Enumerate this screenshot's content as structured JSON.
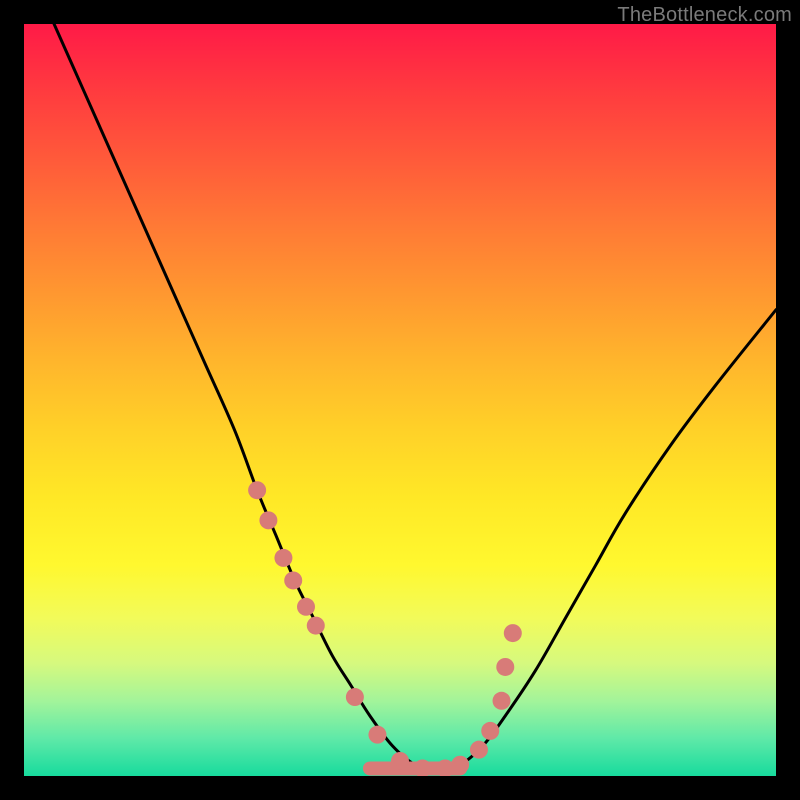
{
  "watermark": "TheBottleneck.com",
  "chart_data": {
    "type": "line",
    "title": "",
    "xlabel": "",
    "ylabel": "",
    "xlim": [
      0,
      100
    ],
    "ylim": [
      0,
      100
    ],
    "grid": false,
    "legend": false,
    "series": [
      {
        "name": "bottleneck-curve",
        "color": "#000000",
        "x": [
          4,
          8,
          12,
          16,
          20,
          24,
          28,
          31,
          33.5,
          36,
          38.5,
          41,
          43.5,
          46,
          49,
          52,
          55,
          58,
          61,
          64,
          68,
          72,
          76,
          80,
          86,
          92,
          100
        ],
        "y": [
          100,
          91,
          82,
          73,
          64,
          55,
          46,
          38,
          32,
          26,
          21,
          16,
          12,
          8,
          4,
          1.5,
          0.8,
          1.5,
          4,
          8,
          14,
          21,
          28,
          35,
          44,
          52,
          62
        ]
      },
      {
        "name": "marker-cluster",
        "color": "#d87b78",
        "markers_only": true,
        "x": [
          31.0,
          32.5,
          34.5,
          35.8,
          37.5,
          38.8,
          44.0,
          47.0,
          50.0,
          53.0,
          56.0,
          58.0,
          60.5,
          62.0,
          63.5,
          64.0,
          65.0
        ],
        "y": [
          38.0,
          34.0,
          29.0,
          26.0,
          22.5,
          20.0,
          10.5,
          5.5,
          2.0,
          1.0,
          1.0,
          1.5,
          3.5,
          6.0,
          10.0,
          14.5,
          19.0
        ]
      }
    ],
    "flat_segment": {
      "x_start": 46,
      "x_end": 58,
      "y": 1.0
    },
    "gradient_stops": [
      {
        "pos": 0.0,
        "color": "#ff1a47"
      },
      {
        "pos": 0.2,
        "color": "#ff6a37"
      },
      {
        "pos": 0.45,
        "color": "#ffb62c"
      },
      {
        "pos": 0.7,
        "color": "#fff128"
      },
      {
        "pos": 0.9,
        "color": "#a3f49a"
      },
      {
        "pos": 1.0,
        "color": "#17db9d"
      }
    ]
  }
}
